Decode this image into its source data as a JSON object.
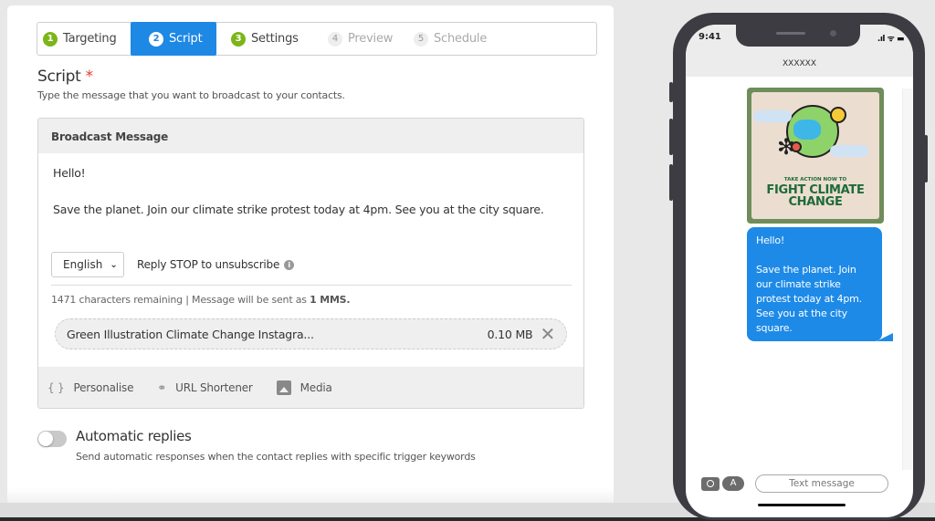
{
  "steps": [
    {
      "num": "1",
      "label": "Targeting",
      "state": "done"
    },
    {
      "num": "2",
      "label": "Script",
      "state": "active"
    },
    {
      "num": "3",
      "label": "Settings",
      "state": "done"
    },
    {
      "num": "4",
      "label": "Preview",
      "state": "disabled"
    },
    {
      "num": "5",
      "label": "Schedule",
      "state": "disabled"
    }
  ],
  "script": {
    "title": "Script",
    "required_mark": "*",
    "subtitle": "Type the message that you want to broadcast to your contacts.",
    "box_title": "Broadcast Message",
    "message_lines": [
      "Hello!",
      "Save the planet. Join our climate strike protest today at 4pm. See you at the city square."
    ],
    "language": "English",
    "reply_stop": "Reply STOP to unsubscribe",
    "info_icon": "i",
    "chars_text": "1471 characters remaining | Message will be sent as ",
    "chars_bold": "1 MMS.",
    "attachment": {
      "name": "Green Illustration Climate Change Instagra...",
      "size": "0.10 MB",
      "remove_icon": "✕"
    },
    "tools": [
      {
        "icon": "{ }",
        "label": "Personalise"
      },
      {
        "icon": "link-icon",
        "label": "URL Shortener"
      },
      {
        "icon": "image-icon",
        "label": "Media"
      }
    ]
  },
  "auto_replies": {
    "enabled": false,
    "title": "Automatic replies",
    "description": "Send automatic responses when the contact replies with specific trigger keywords"
  },
  "phone": {
    "time": "9:41",
    "status": ".ıl ᯤ ▬",
    "contact": "XXXXXX",
    "image_text_small": "TAKE ACTION NOW TO",
    "image_text_big_1": "FIGHT CLIMATE",
    "image_text_big_2": "CHANGE",
    "bubble_lines": [
      "Hello!",
      "Save the planet. Join our climate strike protest today at 4pm. See you at the city square."
    ],
    "input_placeholder": "Text message",
    "apps_icon": "A"
  },
  "colors": {
    "accent": "#1e88e5",
    "step_done": "#7cb518",
    "bubble": "#1e8ae8",
    "required": "#e53935"
  }
}
